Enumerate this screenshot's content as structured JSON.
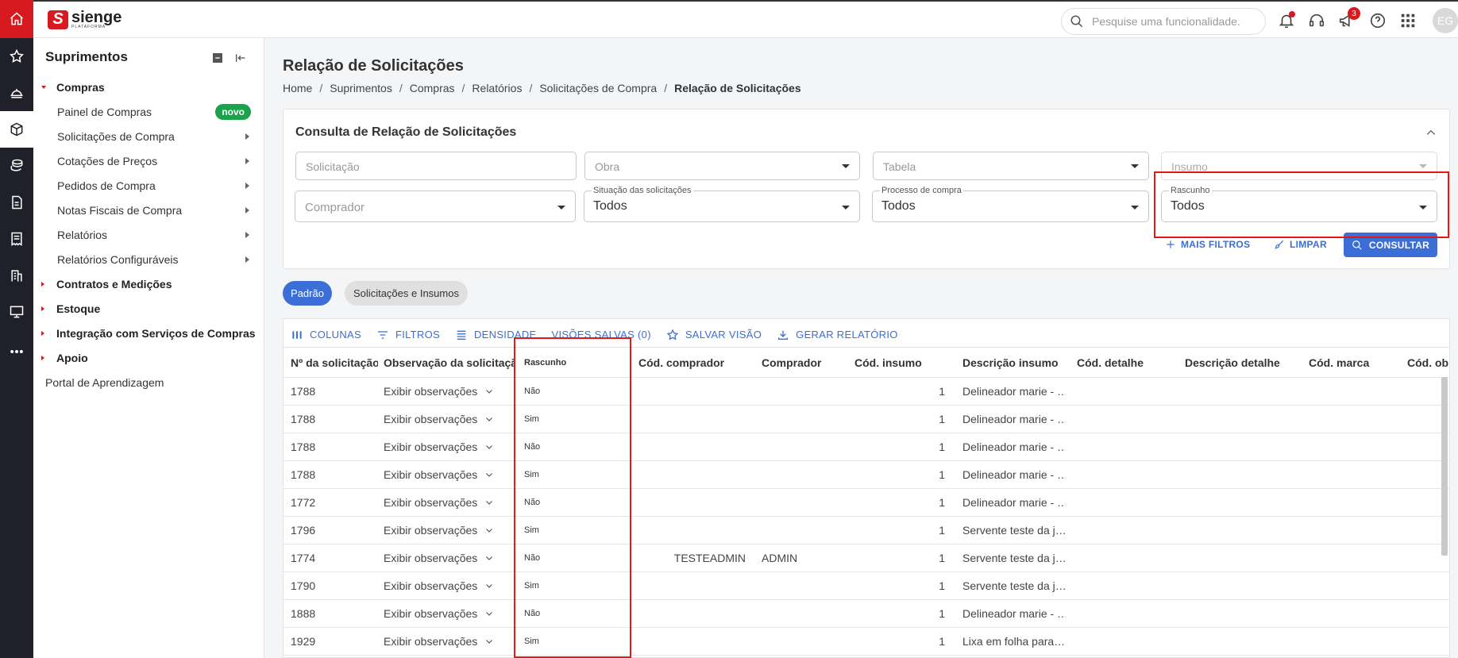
{
  "app": {
    "brand_name": "sienge",
    "brand_sub": "PLATAFORMA",
    "brand_letter": "S",
    "accent_color": "#d71920",
    "primary_color": "#3b6ed6"
  },
  "rail": {
    "items": [
      "home-icon",
      "star-icon",
      "helmet-icon",
      "box-icon",
      "coins-icon",
      "document-icon",
      "invoice-icon",
      "building-icon",
      "monitor-icon",
      "more-icon"
    ]
  },
  "topbar": {
    "search_placeholder": "Pesquise uma funcionalidade.",
    "announcements_badge": "3",
    "avatar_initials": "EG"
  },
  "sidebar": {
    "title": "Suprimentos",
    "groups": [
      {
        "label": "Compras",
        "expanded": true
      },
      {
        "label": "Contratos e Medições"
      },
      {
        "label": "Estoque"
      },
      {
        "label": "Integração com Serviços de Compras"
      },
      {
        "label": "Apoio"
      }
    ],
    "compras_items": [
      {
        "label": "Painel de Compras",
        "badge": "novo"
      },
      {
        "label": "Solicitações de Compra"
      },
      {
        "label": "Cotações de Preços"
      },
      {
        "label": "Pedidos de Compra"
      },
      {
        "label": "Notas Fiscais de Compra"
      },
      {
        "label": "Relatórios"
      },
      {
        "label": "Relatórios Configuráveis"
      }
    ],
    "portal": "Portal de Aprendizagem"
  },
  "page": {
    "title": "Relação de Solicitações",
    "breadcrumb": [
      "Home",
      "Suprimentos",
      "Compras",
      "Relatórios",
      "Solicitações de Compra",
      "Relação de Solicitações"
    ]
  },
  "filters": {
    "title": "Consulta de Relação de Solicitações",
    "solicitacao_placeholder": "Solicitação",
    "obra_placeholder": "Obra",
    "tabela_placeholder": "Tabela",
    "insumo_placeholder": "Insumo",
    "comprador_placeholder": "Comprador",
    "situacao_label": "Situação das solicitações",
    "situacao_value": "Todos",
    "processo_label": "Processo de compra",
    "processo_value": "Todos",
    "rascunho_label": "Rascunho",
    "rascunho_value": "Todos",
    "mais_filtros": "MAIS FILTROS",
    "limpar": "LIMPAR",
    "consultar": "CONSULTAR"
  },
  "views": {
    "active": "Padrão",
    "other": "Solicitações e Insumos"
  },
  "toolbar": {
    "colunas": "COLUNAS",
    "filtros": "FILTROS",
    "densidade": "DENSIDADE",
    "visoes_salvas": "VISÕES SALVAS (0)",
    "salvar_visao": "SALVAR VISÃO",
    "gerar_relatorio": "GERAR RELATÓRIO"
  },
  "table": {
    "columns": [
      "Nº da solicitação",
      "Observação da solicitação",
      "Rascunho",
      "Cód. comprador",
      "Comprador",
      "Cód. insumo",
      "Descrição insumo",
      "Cód. detalhe",
      "Descrição detalhe",
      "Cód. marca",
      "Cód. obra"
    ],
    "rows": [
      {
        "num": "1788",
        "obs": "Exibir observações",
        "rascunho": "Não",
        "cod_comprador": "",
        "comprador": "",
        "cod_insumo": "1",
        "desc_insumo": "Delineador marie - …"
      },
      {
        "num": "1788",
        "obs": "Exibir observações",
        "rascunho": "Sim",
        "cod_comprador": "",
        "comprador": "",
        "cod_insumo": "1",
        "desc_insumo": "Delineador marie - …"
      },
      {
        "num": "1788",
        "obs": "Exibir observações",
        "rascunho": "Não",
        "cod_comprador": "",
        "comprador": "",
        "cod_insumo": "1",
        "desc_insumo": "Delineador marie - …"
      },
      {
        "num": "1788",
        "obs": "Exibir observações",
        "rascunho": "Sim",
        "cod_comprador": "",
        "comprador": "",
        "cod_insumo": "1",
        "desc_insumo": "Delineador marie - …"
      },
      {
        "num": "1772",
        "obs": "Exibir observações",
        "rascunho": "Não",
        "cod_comprador": "",
        "comprador": "",
        "cod_insumo": "1",
        "desc_insumo": "Delineador marie - …"
      },
      {
        "num": "1796",
        "obs": "Exibir observações",
        "rascunho": "Sim",
        "cod_comprador": "",
        "comprador": "",
        "cod_insumo": "1",
        "desc_insumo": "Servente teste da j…"
      },
      {
        "num": "1774",
        "obs": "Exibir observações",
        "rascunho": "Não",
        "cod_comprador": "TESTEADMIN",
        "comprador": "ADMIN",
        "cod_insumo": "1",
        "desc_insumo": "Servente teste da j…"
      },
      {
        "num": "1790",
        "obs": "Exibir observações",
        "rascunho": "Sim",
        "cod_comprador": "",
        "comprador": "",
        "cod_insumo": "1",
        "desc_insumo": "Servente teste da j…"
      },
      {
        "num": "1888",
        "obs": "Exibir observações",
        "rascunho": "Não",
        "cod_comprador": "",
        "comprador": "",
        "cod_insumo": "1",
        "desc_insumo": "Delineador marie - …"
      },
      {
        "num": "1929",
        "obs": "Exibir observações",
        "rascunho": "Sim",
        "cod_comprador": "",
        "comprador": "",
        "cod_insumo": "1",
        "desc_insumo": "Lixa em folha para…"
      }
    ]
  }
}
